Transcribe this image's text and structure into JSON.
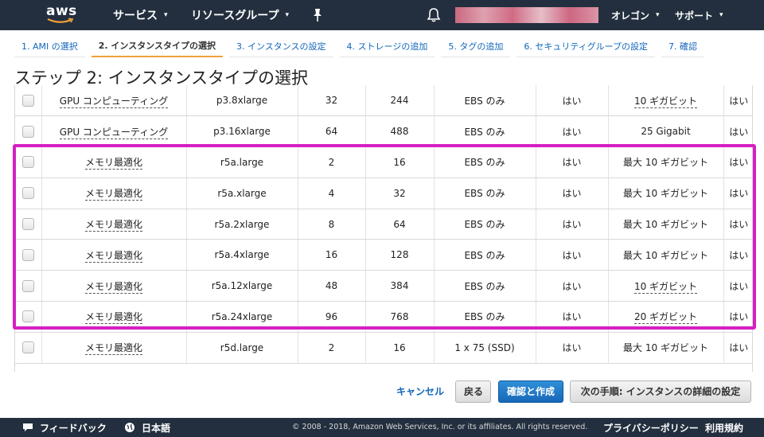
{
  "nav": {
    "logo_text": "aws",
    "services": "サービス",
    "resource_groups": "リソースグループ",
    "region": "オレゴン",
    "support": "サポート"
  },
  "tabs": [
    {
      "label": "1. AMI の選択"
    },
    {
      "label": "2. インスタンスタイプの選択"
    },
    {
      "label": "3. インスタンスの設定"
    },
    {
      "label": "4. ストレージの追加"
    },
    {
      "label": "5. タグの追加"
    },
    {
      "label": "6. セキュリティグループの設定"
    },
    {
      "label": "7. 確認"
    }
  ],
  "page_title": "ステップ 2: インスタンスタイプの選択",
  "table": {
    "rows": [
      {
        "family": "GPU コンピューティング",
        "type": "p3.8xlarge",
        "vcpu": "32",
        "memory": "244",
        "storage": "EBS のみ",
        "ebs_opt": "はい",
        "network": "10 ギガビット",
        "network_dotted": true,
        "ipv6": "はい"
      },
      {
        "family": "GPU コンピューティング",
        "type": "p3.16xlarge",
        "vcpu": "64",
        "memory": "488",
        "storage": "EBS のみ",
        "ebs_opt": "はい",
        "network": "25 Gigabit",
        "network_dotted": false,
        "ipv6": "はい"
      },
      {
        "family": "メモリ最適化",
        "type": "r5a.large",
        "vcpu": "2",
        "memory": "16",
        "storage": "EBS のみ",
        "ebs_opt": "はい",
        "network": "最大 10 ギガビット",
        "network_dotted": false,
        "ipv6": "はい"
      },
      {
        "family": "メモリ最適化",
        "type": "r5a.xlarge",
        "vcpu": "4",
        "memory": "32",
        "storage": "EBS のみ",
        "ebs_opt": "はい",
        "network": "最大 10 ギガビット",
        "network_dotted": false,
        "ipv6": "はい"
      },
      {
        "family": "メモリ最適化",
        "type": "r5a.2xlarge",
        "vcpu": "8",
        "memory": "64",
        "storage": "EBS のみ",
        "ebs_opt": "はい",
        "network": "最大 10 ギガビット",
        "network_dotted": false,
        "ipv6": "はい"
      },
      {
        "family": "メモリ最適化",
        "type": "r5a.4xlarge",
        "vcpu": "16",
        "memory": "128",
        "storage": "EBS のみ",
        "ebs_opt": "はい",
        "network": "最大 10 ギガビット",
        "network_dotted": false,
        "ipv6": "はい"
      },
      {
        "family": "メモリ最適化",
        "type": "r5a.12xlarge",
        "vcpu": "48",
        "memory": "384",
        "storage": "EBS のみ",
        "ebs_opt": "はい",
        "network": "10 ギガビット",
        "network_dotted": true,
        "ipv6": "はい"
      },
      {
        "family": "メモリ最適化",
        "type": "r5a.24xlarge",
        "vcpu": "96",
        "memory": "768",
        "storage": "EBS のみ",
        "ebs_opt": "はい",
        "network": "20 ギガビット",
        "network_dotted": true,
        "ipv6": "はい"
      },
      {
        "family": "メモリ最適化",
        "type": "r5d.large",
        "vcpu": "2",
        "memory": "16",
        "storage": "1 x 75 (SSD)",
        "ebs_opt": "はい",
        "network": "最大 10 ギガビット",
        "network_dotted": false,
        "ipv6": "はい"
      }
    ]
  },
  "actions": {
    "cancel": "キャンセル",
    "back": "戻る",
    "review_launch": "確認と作成",
    "next": "次の手順: インスタンスの詳細の設定"
  },
  "footer": {
    "feedback": "フィードバック",
    "language": "日本語",
    "copyright": "© 2008 - 2018, Amazon Web Services, Inc. or its affiliates. All rights reserved.",
    "privacy": "プライバシーポリシー",
    "terms": "利用規約"
  },
  "colors": {
    "nav_bg": "#232f3e",
    "highlight": "#d61fc3",
    "primary_button": "#1768b8",
    "link": "#1166bb",
    "active_tab_underline": "#f0a03a"
  }
}
